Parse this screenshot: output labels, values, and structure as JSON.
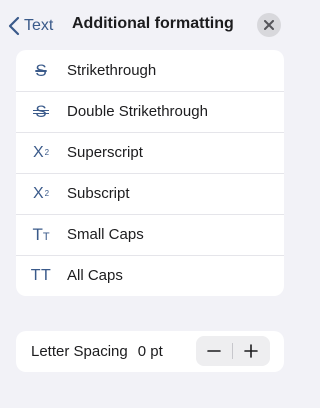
{
  "header": {
    "back_label": "Text",
    "title": "Additional formatting",
    "back_icon": "chevron-left-icon",
    "close_icon": "close-icon"
  },
  "options": [
    {
      "label": "Strikethrough",
      "icon": "strikethrough-icon",
      "glyph": "S"
    },
    {
      "label": "Double Strikethrough",
      "icon": "double-strikethrough-icon",
      "glyph": "S"
    },
    {
      "label": "Superscript",
      "icon": "superscript-icon",
      "glyph": "X",
      "mark": "2"
    },
    {
      "label": "Subscript",
      "icon": "subscript-icon",
      "glyph": "X",
      "mark": "2"
    },
    {
      "label": "Small Caps",
      "icon": "small-caps-icon",
      "glyph": "T",
      "mark": "T"
    },
    {
      "label": "All Caps",
      "icon": "all-caps-icon",
      "glyph": "TT"
    }
  ],
  "letter_spacing": {
    "label": "Letter Spacing",
    "value": "0 pt",
    "decrement_icon": "minus-icon",
    "increment_icon": "plus-icon"
  },
  "colors": {
    "accent": "#3a5a8a",
    "background": "#f2f2f7",
    "card": "#ffffff",
    "close_button_bg": "#d8d8dc"
  }
}
